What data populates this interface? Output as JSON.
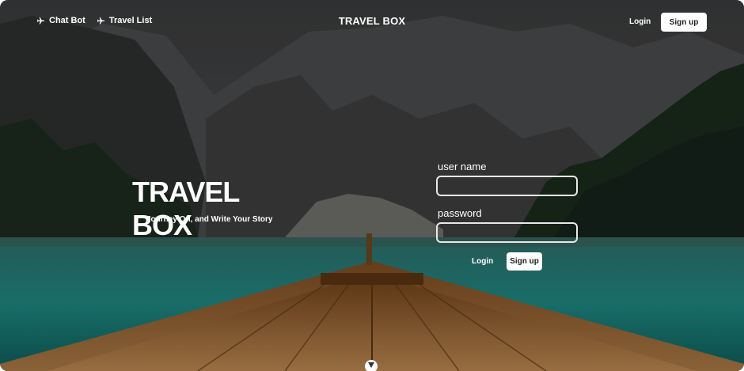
{
  "nav": {
    "chatbot_label": "Chat Bot",
    "travel_list_label": "Travel List",
    "brand": "TRAVEL BOX",
    "login_label": "Login",
    "signup_label": "Sign up"
  },
  "hero": {
    "title": "TRAVEL BOX",
    "subtitle": "Journey On, and Write Your Story"
  },
  "form": {
    "username_label": "user name",
    "username_value": "",
    "password_label": "password",
    "password_value": "",
    "login_label": "Login",
    "signup_label": "Sign up"
  },
  "icons": {
    "nav_icon": "airplane-icon",
    "scroll_icon": "chevron-down-icon"
  },
  "colors": {
    "lake": "#1f6f6a",
    "boat_wood": "#8a5a2b",
    "button_bg": "#ffffff",
    "text": "#ffffff"
  }
}
